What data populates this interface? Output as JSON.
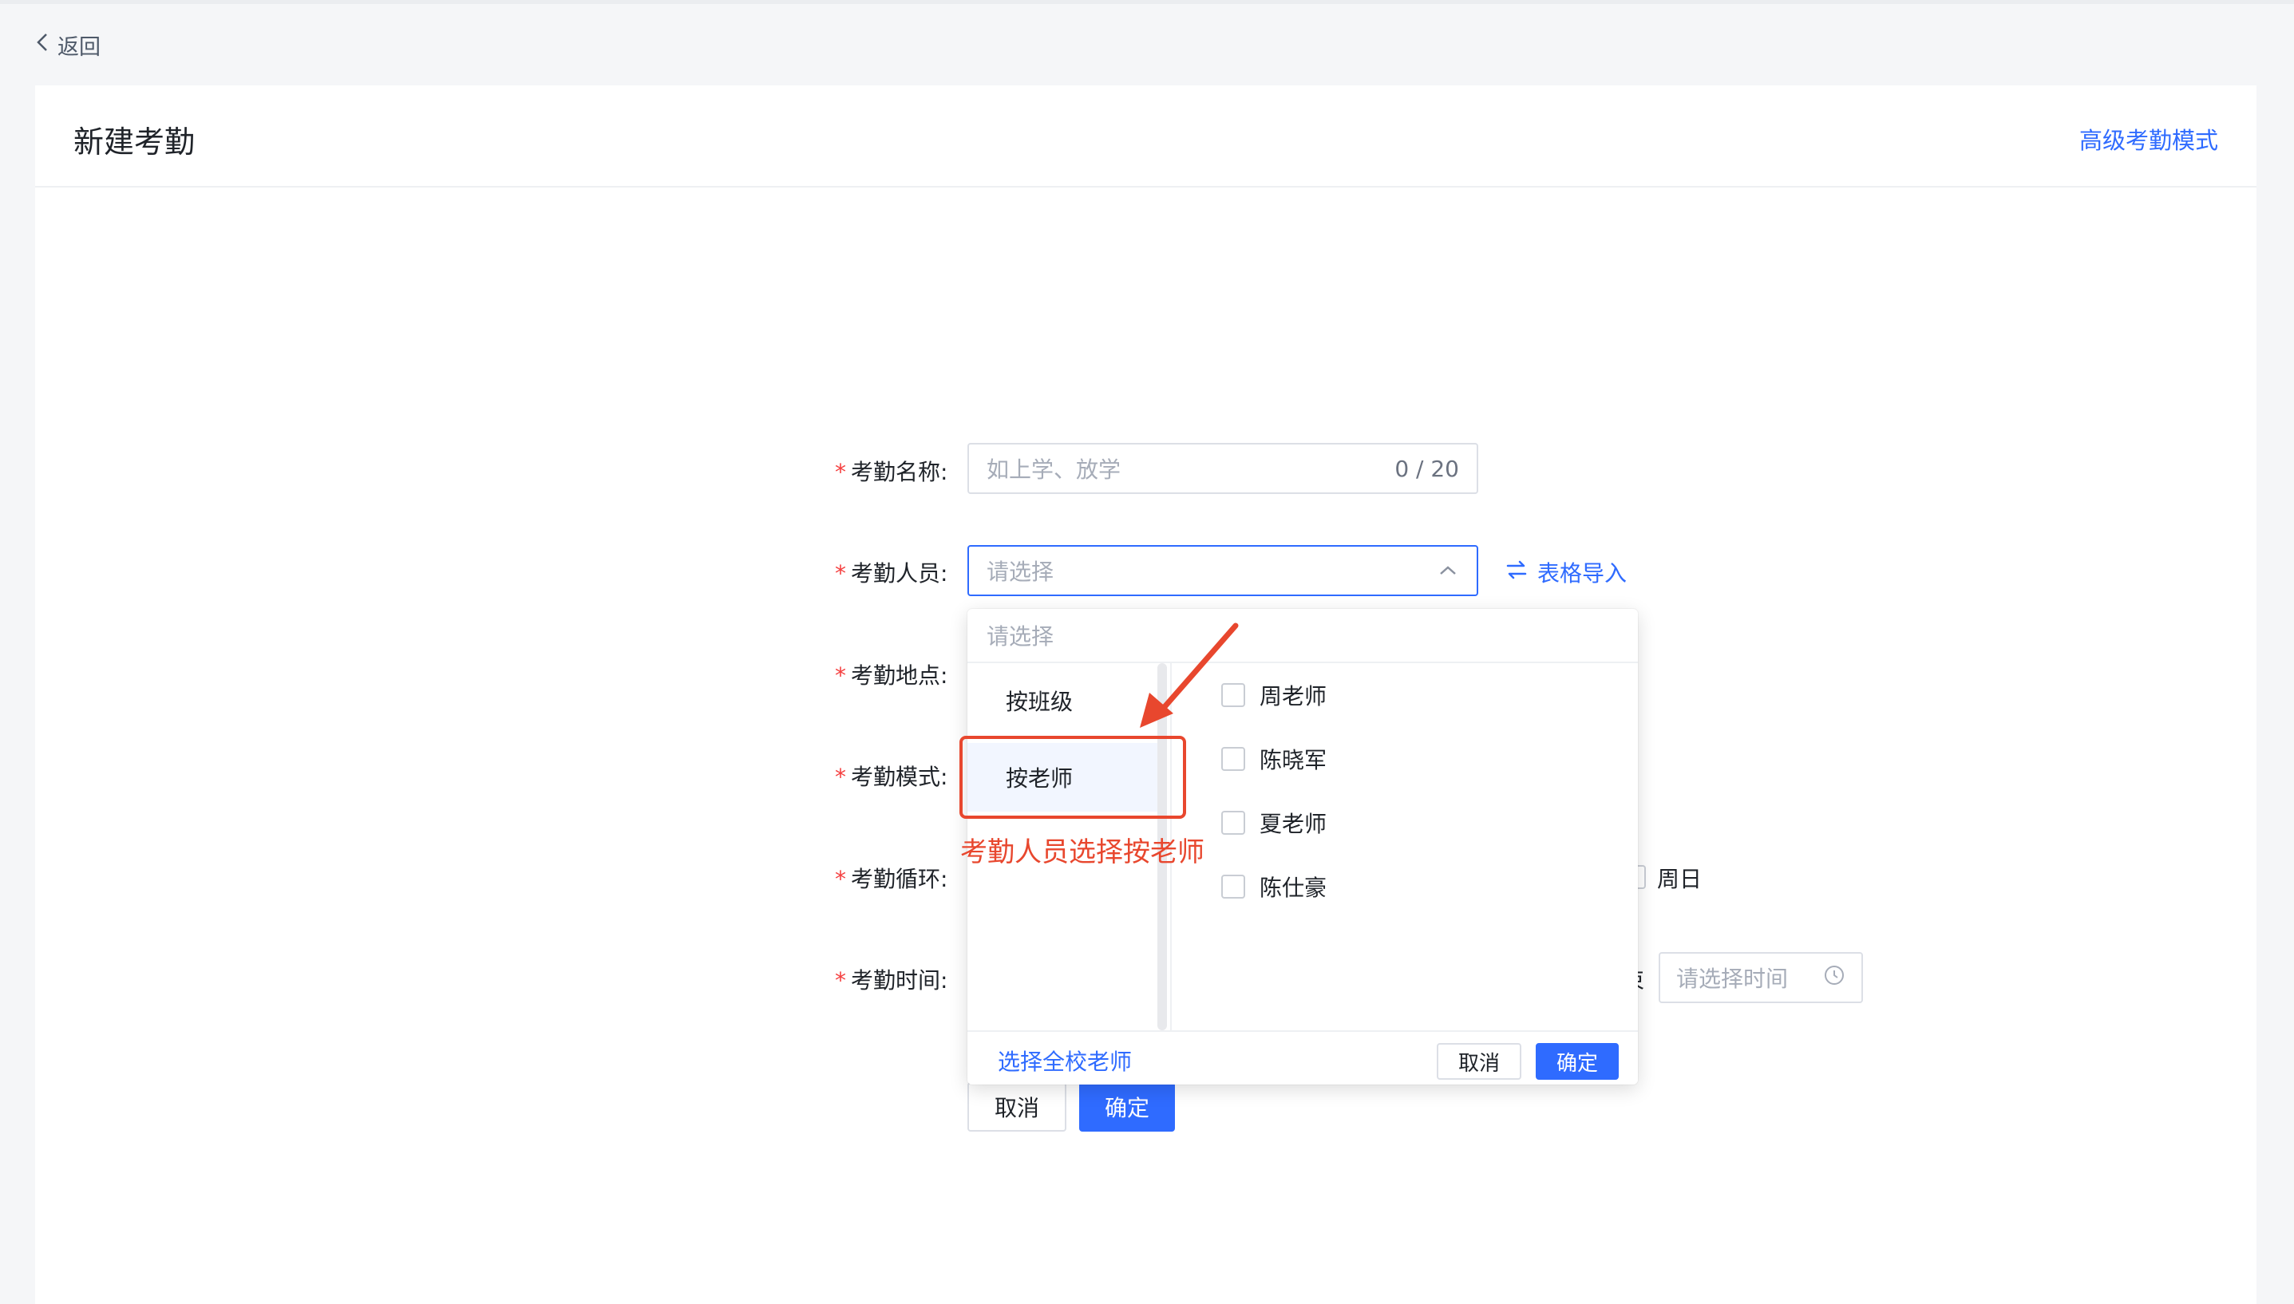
{
  "nav": {
    "back_label": "返回"
  },
  "header": {
    "title": "新建考勤",
    "advanced_mode_label": "高级考勤模式"
  },
  "form": {
    "name": {
      "label": "考勤名称:",
      "placeholder": "如上学、放学",
      "counter": "0 / 20"
    },
    "personnel": {
      "label": "考勤人员:",
      "placeholder": "请选择",
      "import_label": "表格导入"
    },
    "location": {
      "label": "考勤地点:"
    },
    "mode": {
      "label": "考勤模式:"
    },
    "cycle": {
      "label": "考勤循环:",
      "sunday_label": "周日"
    },
    "time": {
      "label": "考勤时间:",
      "end_suffix": "束",
      "end_placeholder": "请选择时间"
    }
  },
  "dropdown": {
    "search_placeholder": "请选择",
    "categories": [
      {
        "label": "按班级"
      },
      {
        "label": "按老师",
        "selected": true
      }
    ],
    "teachers": [
      {
        "name": "周老师"
      },
      {
        "name": "陈晓军"
      },
      {
        "name": "夏老师"
      },
      {
        "name": "陈仕豪"
      }
    ],
    "select_all_label": "选择全校老师",
    "cancel_label": "取消",
    "confirm_label": "确定"
  },
  "actions": {
    "cancel_label": "取消",
    "confirm_label": "确定"
  },
  "annotation": {
    "text": "考勤人员选择按老师",
    "color": "#e8472e"
  },
  "colors": {
    "primary": "#2f6bff",
    "required": "#f53f3f"
  }
}
